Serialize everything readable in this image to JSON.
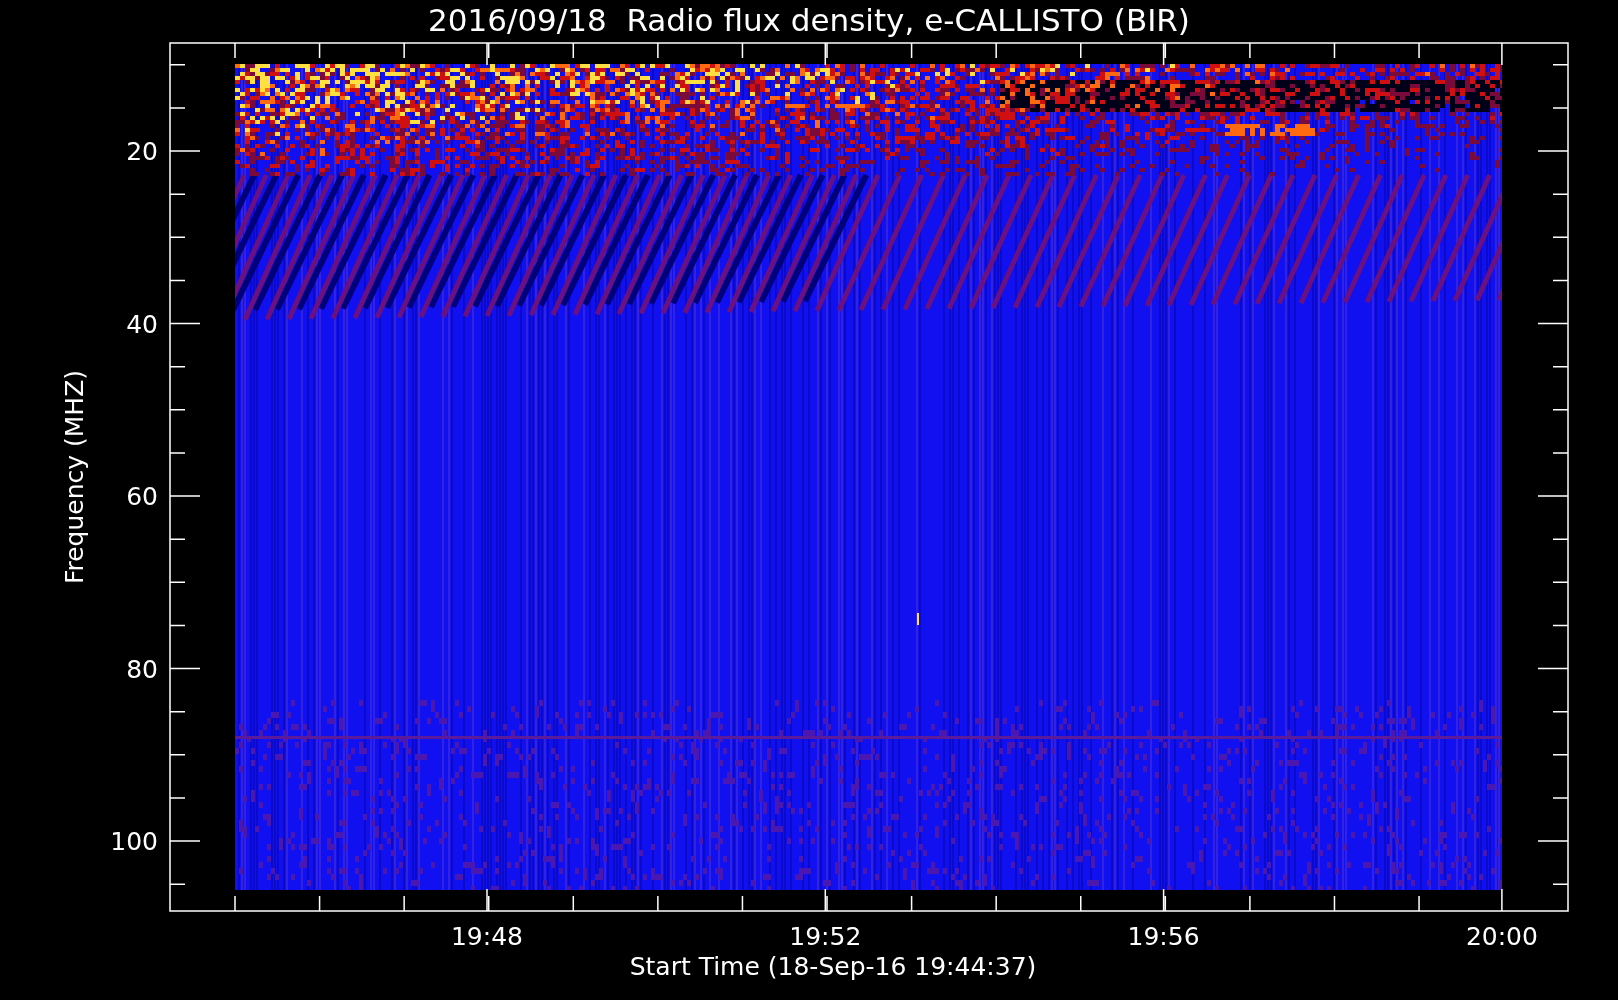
{
  "title": "2016/09/18  Radio flux density, e-CALLISTO (BIR)",
  "xlabel": "Start Time (18-Sep-16 19:44:37)",
  "ylabel": "Frequency (MHZ)",
  "yticks": [
    "20",
    "40",
    "60",
    "80",
    "100"
  ],
  "xticks": [
    "19:48",
    "19:52",
    "19:56",
    "20:00"
  ]
}
